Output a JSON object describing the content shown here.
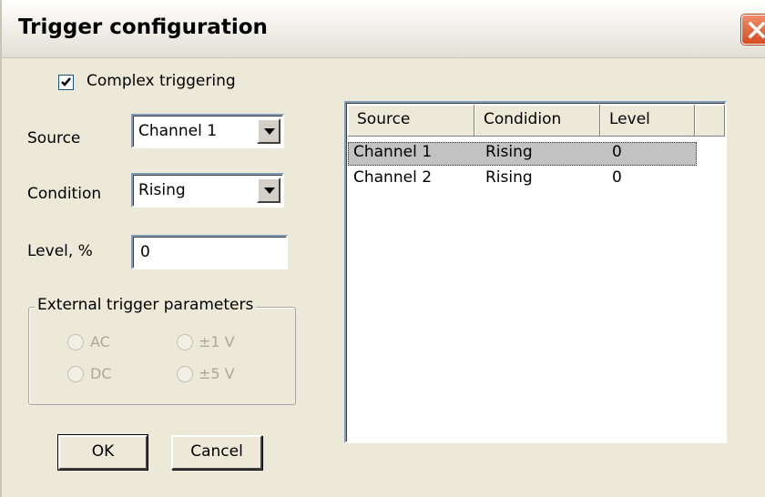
{
  "window": {
    "title": "Trigger configuration"
  },
  "options": {
    "complex_triggering_label": "Complex triggering",
    "complex_triggering_checked": true
  },
  "form": {
    "source_label": "Source",
    "source_value": "Channel 1",
    "condition_label": "Condition",
    "condition_value": "Rising",
    "level_label": "Level, %",
    "level_value": "0"
  },
  "external": {
    "title": "External trigger parameters",
    "options": [
      "AC",
      "±1 V",
      "DC",
      "±5 V"
    ]
  },
  "buttons": {
    "ok": "OK",
    "cancel": "Cancel"
  },
  "table": {
    "columns": [
      "Source",
      "Condidion",
      "Level"
    ],
    "rows": [
      {
        "source": "Channel 1",
        "condition": "Rising",
        "level": "0",
        "selected": true
      },
      {
        "source": "Channel 2",
        "condition": "Rising",
        "level": "0",
        "selected": false
      }
    ]
  },
  "colors": {
    "selection": "#c2c2c2",
    "close_button": "#d74c22",
    "dialog_bg": "#ece9d8"
  }
}
